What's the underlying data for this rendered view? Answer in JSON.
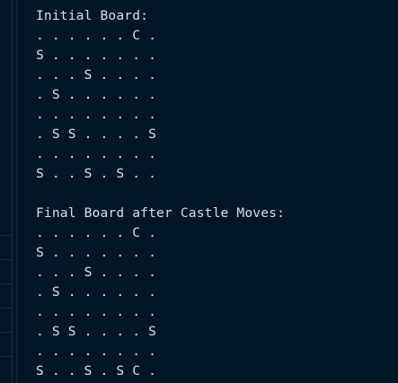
{
  "output": {
    "initial_title": "Initial Board:",
    "initial_rows": [
      ". . . . . . C .",
      "S . . . . . . .",
      ". . . S . . . .",
      ". S . . . . . .",
      ". . . . . . . .",
      ". S S . . . . S",
      ". . . . . . . .",
      "S . . S . S . ."
    ],
    "final_title": "Final Board after Castle Moves:",
    "final_rows": [
      ". . . . . . C .",
      "S . . . . . . .",
      ". . . S . . . .",
      ". S . . . . . .",
      ". . . . . . . .",
      ". S S . . . . S",
      ". . . . . . . .",
      "S . . S . S C ."
    ]
  }
}
